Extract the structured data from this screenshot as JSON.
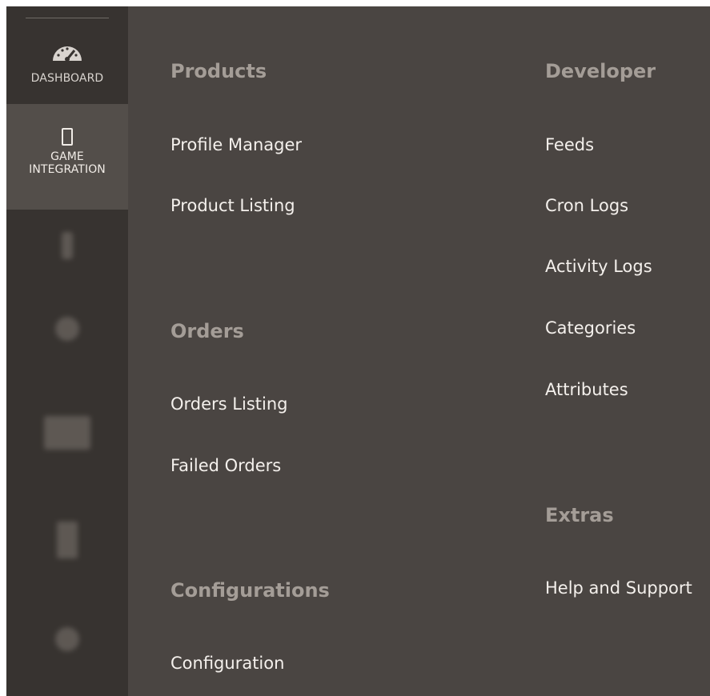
{
  "sidebar": {
    "items": [
      {
        "label": "DASHBOARD",
        "icon": "dashboard-gauge-icon"
      },
      {
        "label_line1": "GAME",
        "label_line2": "INTEGRATION",
        "icon": "mobile-device-icon"
      }
    ]
  },
  "menu": {
    "products": {
      "heading": "Products",
      "links": [
        "Profile Manager",
        "Product Listing"
      ]
    },
    "orders": {
      "heading": "Orders",
      "links": [
        "Orders Listing",
        "Failed Orders"
      ]
    },
    "configurations": {
      "heading": "Configurations",
      "links": [
        "Configuration"
      ]
    },
    "developer": {
      "heading": "Developer",
      "links": [
        "Feeds",
        "Cron Logs",
        "Activity Logs",
        "Categories",
        "Attributes"
      ]
    },
    "extras": {
      "heading": "Extras",
      "links": [
        "Help and Support"
      ]
    }
  },
  "colors": {
    "panel_bg": "#4a4542",
    "sidebar_bg": "#373330",
    "active_item_bg": "#534e4a",
    "heading_text": "#a49d97",
    "link_text": "#f4f0ec"
  }
}
